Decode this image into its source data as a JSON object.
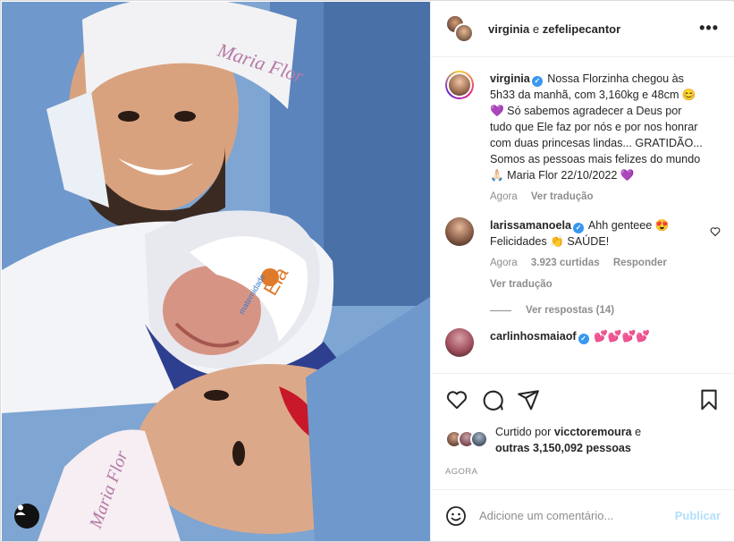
{
  "header": {
    "user_one": "virginia",
    "conjunction": "e",
    "user_two": "zefelipecantor",
    "more_label": "•••"
  },
  "caption": {
    "username": "virginia",
    "text": "Nossa Florzinha chegou às 5h33 da manhã, com 3,160kg e 48cm 😊 💜 Só sabemos agradecer a Deus por tudo que Ele faz por nós e por nos honrar com duas princesas lindas... GRATIDÃO... Somos as pessoas mais felizes do mundo 🙏🏻 Maria Flor 22/10/2022 💜",
    "time": "Agora",
    "translate": "Ver tradução"
  },
  "comments": [
    {
      "username": "larissamanoela",
      "text": "Ahh genteee 😍 Felicidades 👏 SAÚDE!",
      "time": "Agora",
      "likes": "3.923 curtidas",
      "reply": "Responder",
      "translate": "Ver tradução",
      "view_replies": "Ver respostas (14)"
    },
    {
      "username": "carlinhosmaiaof",
      "text": "💕💕💕💕"
    }
  ],
  "photo": {
    "cap_text_top": "Maria Flor",
    "hat_logo_text": "Ela",
    "hat_logo_sub": "maternidade",
    "cap_text_bottom": "Maria Flor"
  },
  "actions": {
    "like_icon": "heart-icon",
    "comment_icon": "comment-icon",
    "share_icon": "send-icon",
    "save_icon": "bookmark-icon"
  },
  "likes": {
    "prefix": "Curtido por",
    "user": "vicctoremoura",
    "middle": "e",
    "others": "outras 3,150,092 pessoas"
  },
  "timestamp": "AGORA",
  "add_comment": {
    "placeholder": "Adicione um comentário...",
    "publish": "Publicar"
  },
  "colors": {
    "verified": "#3897f0",
    "publish_disabled": "#b2dffc",
    "muted": "#8e8e8e",
    "purple_heart": "#8e44ad"
  }
}
